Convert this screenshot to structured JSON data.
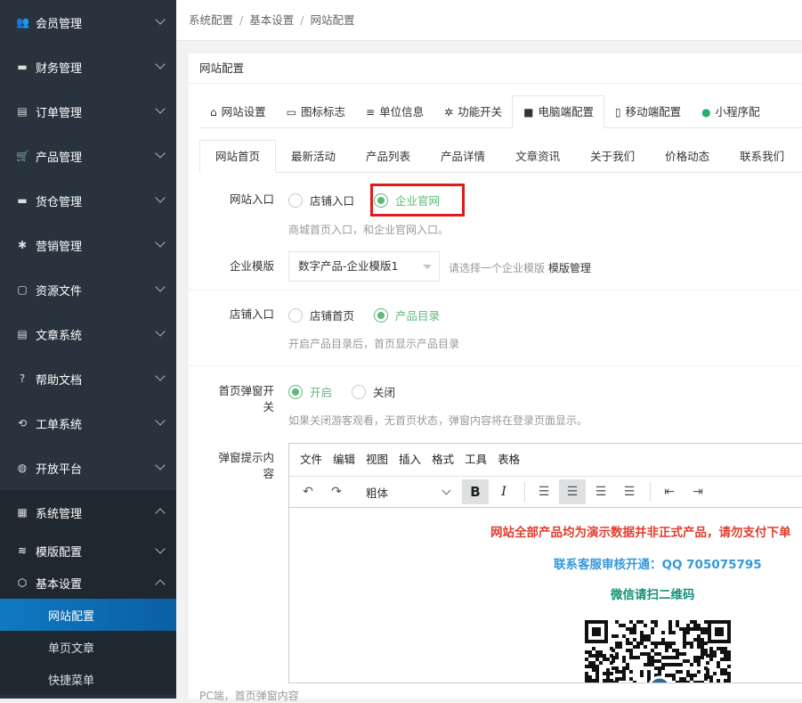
{
  "sidebar": {
    "items": [
      {
        "label": "会员管理",
        "icon": "users-icon"
      },
      {
        "label": "财务管理",
        "icon": "finance-icon"
      },
      {
        "label": "订单管理",
        "icon": "order-icon"
      },
      {
        "label": "产品管理",
        "icon": "cart-icon"
      },
      {
        "label": "货仓管理",
        "icon": "warehouse-icon"
      },
      {
        "label": "营销管理",
        "icon": "marketing-icon"
      },
      {
        "label": "资源文件",
        "icon": "file-icon"
      },
      {
        "label": "文章系统",
        "icon": "article-icon"
      },
      {
        "label": "帮助文档",
        "icon": "help-icon"
      },
      {
        "label": "工单系统",
        "icon": "ticket-icon"
      },
      {
        "label": "开放平台",
        "icon": "globe-icon"
      },
      {
        "label": "系统管理",
        "icon": "system-icon"
      }
    ],
    "sub": [
      {
        "label": "模版配置",
        "icon": "layers-icon"
      },
      {
        "label": "基本设置",
        "icon": "cube-icon"
      }
    ],
    "leaves": [
      "网站配置",
      "单页文章",
      "快捷菜单"
    ]
  },
  "breadcrumb": {
    "a": "系统配置",
    "b": "基本设置",
    "c": "网站配置",
    "sep": "/"
  },
  "card_title": "网站配置",
  "tabs1": [
    {
      "label": "网站设置",
      "icon": "home-icon",
      "glyph": "⌂"
    },
    {
      "label": "图标标志",
      "icon": "image-icon",
      "glyph": "▭"
    },
    {
      "label": "单位信息",
      "icon": "doc-icon",
      "glyph": "≡"
    },
    {
      "label": "功能开关",
      "icon": "gear-icon",
      "glyph": "✲"
    },
    {
      "label": "电脑端配置",
      "icon": "windows-icon",
      "glyph": "■"
    },
    {
      "label": "移动端配置",
      "icon": "mobile-icon",
      "glyph": "▯"
    },
    {
      "label": "小程序配",
      "icon": "wechat-icon",
      "glyph": "●"
    }
  ],
  "tabs2": [
    "网站首页",
    "最新活动",
    "产品列表",
    "产品详情",
    "文章资讯",
    "关于我们",
    "价格动态",
    "联系我们"
  ],
  "form": {
    "entry": {
      "label": "网站入口",
      "opt1": "店铺入口",
      "opt2": "企业官网",
      "hint": "商城首页入口，和企业官网入口。"
    },
    "template": {
      "label": "企业模版",
      "value": "数字产品-企业模版1",
      "hint": "请选择一个企业模版",
      "link": "模版管理"
    },
    "store": {
      "label": "店铺入口",
      "opt1": "店铺首页",
      "opt2": "产品目录",
      "hint": "开启产品目录后，首页显示产品目录"
    },
    "popup": {
      "label1": "首页弹窗开",
      "label2": "关",
      "opt1": "开启",
      "opt2": "关闭",
      "hint": "如果关闭游客观看，无首页状态，弹窗内容将在登录页面显示。"
    },
    "popup_content": {
      "label1": "弹窗提示内",
      "label2": "容"
    }
  },
  "editor": {
    "menus": [
      "文件",
      "编辑",
      "视图",
      "插入",
      "格式",
      "工具",
      "表格"
    ],
    "font": "粗体",
    "lines": {
      "red": "网站全部产品均为演示数据并非正式产品，请勿支付下单",
      "blue": "联系客服审核开通：QQ 705075795",
      "green": "微信请扫二维码"
    },
    "colors": {
      "red": "#e03e2d",
      "blue": "#3598db",
      "green": "#169179"
    }
  },
  "footer_hint": "PC端，首页弹窗内容"
}
